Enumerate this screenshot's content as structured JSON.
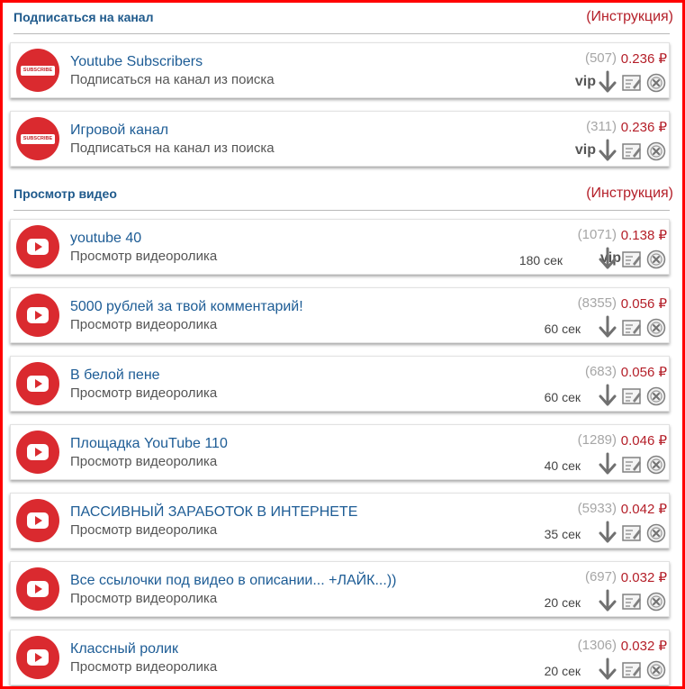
{
  "sections": [
    {
      "title": "Подписаться на канал",
      "link": "(Инструкция)",
      "items": [
        {
          "title": "Youtube Subscribers",
          "subtitle": "Подписаться на канал из поиска",
          "count": "(507)",
          "price": "0.236 ₽",
          "vip": "vip",
          "duration": "",
          "logo": "subscribe-logo"
        },
        {
          "title": "Игровой канал",
          "subtitle": "Подписаться на канал из поиска",
          "count": "(311)",
          "price": "0.236 ₽",
          "vip": "vip",
          "duration": "",
          "logo": "subscribe-logo"
        }
      ]
    },
    {
      "title": "Просмотр видео",
      "link": "(Инструкция)",
      "items": [
        {
          "title": "youtube 40",
          "subtitle": "Просмотр видеоролика",
          "count": "(1071)",
          "price": "0.138 ₽",
          "vip": "vip",
          "duration": "180 сек",
          "logo": "youtube-logo"
        },
        {
          "title": "5000 рублей за твой комментарий!",
          "subtitle": "Просмотр видеоролика",
          "count": "(8355)",
          "price": "0.056 ₽",
          "vip": "",
          "duration": "60 сек",
          "logo": "youtube-logo"
        },
        {
          "title": "В белой пене",
          "subtitle": "Просмотр видеоролика",
          "count": "(683)",
          "price": "0.056 ₽",
          "vip": "",
          "duration": "60 сек",
          "logo": "youtube-logo"
        },
        {
          "title": "Площадка YouTube 110",
          "subtitle": "Просмотр видеоролика",
          "count": "(1289)",
          "price": "0.046 ₽",
          "vip": "",
          "duration": "40 сек",
          "logo": "youtube-logo"
        },
        {
          "title": "ПАССИВНЫЙ ЗАРАБОТОК В ИНТЕРНЕТЕ",
          "subtitle": "Просмотр видеоролика",
          "count": "(5933)",
          "price": "0.042 ₽",
          "vip": "",
          "duration": "35 сек",
          "logo": "youtube-logo"
        },
        {
          "title": "Все ссылочки под видео в описании... +ЛАЙК...))",
          "subtitle": "Просмотр видеоролика",
          "count": "(697)",
          "price": "0.032 ₽",
          "vip": "",
          "duration": "20 сек",
          "logo": "youtube-logo"
        },
        {
          "title": "Классный ролик",
          "subtitle": "Просмотр видеоролика",
          "count": "(1306)",
          "price": "0.032 ₽",
          "vip": "",
          "duration": "20 сек",
          "logo": "youtube-logo"
        }
      ]
    }
  ],
  "logo_text": "SUBSCRIBE",
  "colors": {
    "frame": "#ff0000",
    "title": "#1d5c95",
    "price": "#b41e28",
    "count": "#a6a6a6",
    "logo": "#da2a2f"
  },
  "icons": {
    "down": "arrow-down-icon",
    "edit": "edit-icon",
    "close": "close-circle-icon"
  }
}
